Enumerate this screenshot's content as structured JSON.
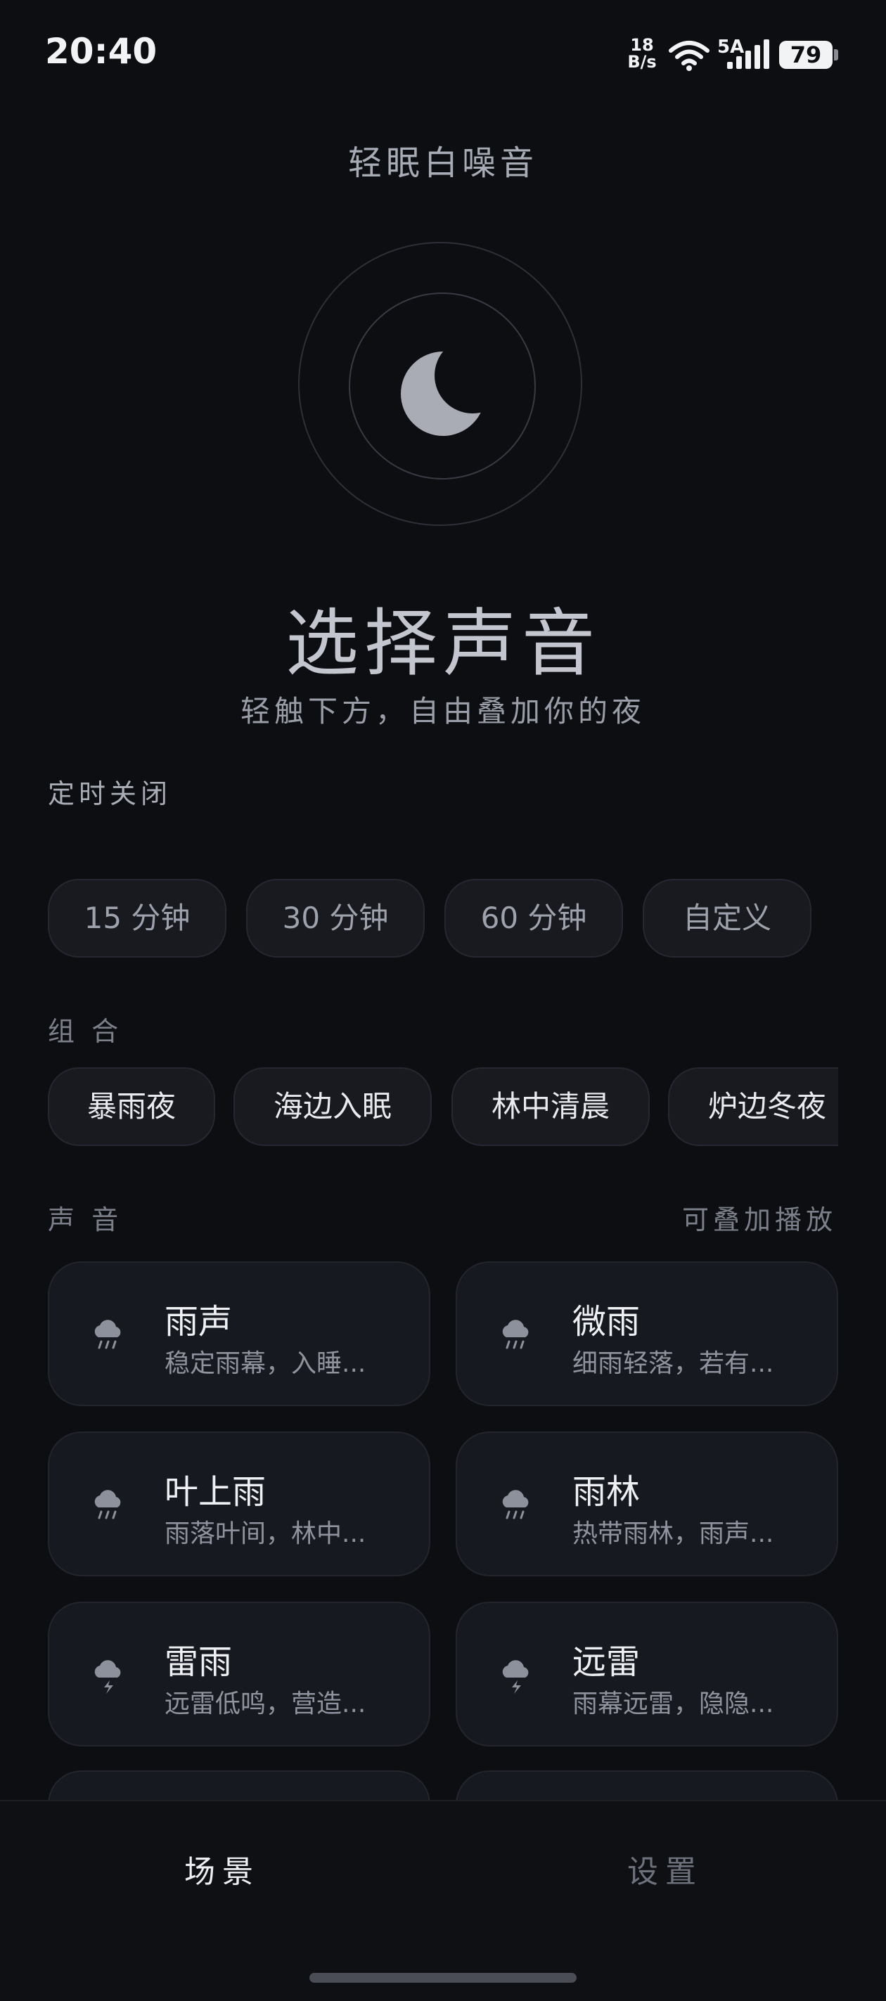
{
  "status_bar": {
    "time": "20:40",
    "net_speed_value": "18",
    "net_speed_unit": "B/s",
    "signal_label": "5A",
    "battery": "79"
  },
  "app_title": "轻眠白噪音",
  "hero_icon": "moon-icon",
  "headline": "选择声音",
  "subline": "轻触下方，自由叠加你的夜",
  "timer": {
    "label": "定时关闭",
    "options": [
      "15 分钟",
      "30 分钟",
      "60 分钟",
      "自定义"
    ]
  },
  "combos": {
    "label": "组 合",
    "items": [
      "暴雨夜",
      "海边入眠",
      "林中清晨",
      "炉边冬夜"
    ]
  },
  "sounds": {
    "label": "声 音",
    "hint": "可叠加播放",
    "items": [
      {
        "name": "雨声",
        "desc": "稳定雨幕，入睡...",
        "icon": "rain-cloud-icon"
      },
      {
        "name": "微雨",
        "desc": "细雨轻落，若有...",
        "icon": "rain-cloud-icon"
      },
      {
        "name": "叶上雨",
        "desc": "雨落叶间，林中...",
        "icon": "rain-cloud-icon"
      },
      {
        "name": "雨林",
        "desc": "热带雨林，雨声...",
        "icon": "rain-cloud-icon"
      },
      {
        "name": "雷雨",
        "desc": "远雷低鸣，营造...",
        "icon": "thunder-cloud-icon"
      },
      {
        "name": "远雷",
        "desc": "雨幕远雷，隐隐...",
        "icon": "thunder-cloud-icon"
      }
    ]
  },
  "tabs": [
    {
      "label": "场景",
      "active": true
    },
    {
      "label": "设置",
      "active": false
    }
  ],
  "colors": {
    "background": "#0d0e12",
    "card": "#171920",
    "accent_moon": "#a9acb5"
  }
}
